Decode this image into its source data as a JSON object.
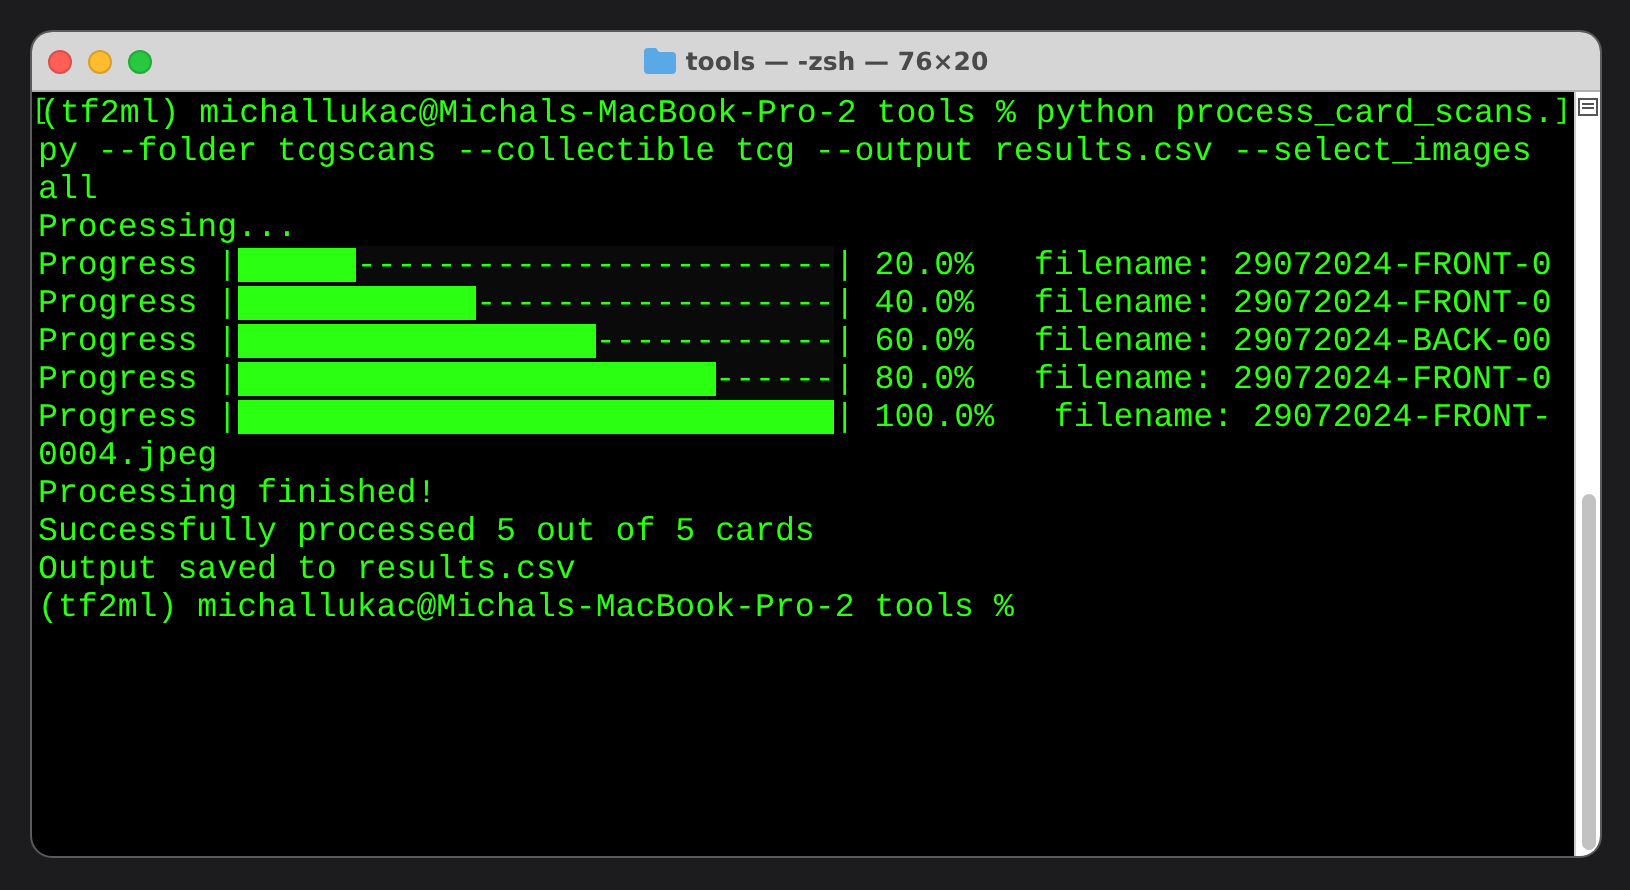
{
  "window": {
    "title": "tools — -zsh — 76×20"
  },
  "lines": [
    {
      "kind": "marked",
      "open": "[",
      "text": "(tf2ml) michallukac@Michals-MacBook-Pro-2 tools % python process_card_scans.",
      "close": "]"
    },
    {
      "kind": "text",
      "text": "py --folder tcgscans --collectible tcg --output results.csv --select_images"
    },
    {
      "kind": "text",
      "text": "all"
    },
    {
      "kind": "text",
      "text": "Processing..."
    },
    {
      "kind": "progress",
      "label": "Progress |",
      "level": 0.2,
      "dashes": "------------------------",
      "tail": "| 20.0%   filename: 29072024-FRONT-0"
    },
    {
      "kind": "progress",
      "label": "Progress |",
      "level": 0.4,
      "dashes": "------------------",
      "tail": "| 40.0%   filename: 29072024-FRONT-0"
    },
    {
      "kind": "progress",
      "label": "Progress |",
      "level": 0.6,
      "dashes": "------------",
      "tail": "| 60.0%   filename: 29072024-BACK-00"
    },
    {
      "kind": "progress",
      "label": "Progress |",
      "level": 0.8,
      "dashes": "------",
      "tail": "| 80.0%   filename: 29072024-FRONT-0"
    },
    {
      "kind": "progress",
      "label": "Progress |",
      "level": 1.0,
      "tail": "| 100.0%   filename: 29072024-FRONT-"
    },
    {
      "kind": "text",
      "text": "0004.jpeg"
    },
    {
      "kind": "text",
      "text": "Processing finished!"
    },
    {
      "kind": "text",
      "text": "Successfully processed 5 out of 5 cards"
    },
    {
      "kind": "text",
      "text": "Output saved to results.csv"
    },
    {
      "kind": "text",
      "text": "(tf2ml) michallukac@Michals-MacBook-Pro-2 tools %"
    }
  ]
}
